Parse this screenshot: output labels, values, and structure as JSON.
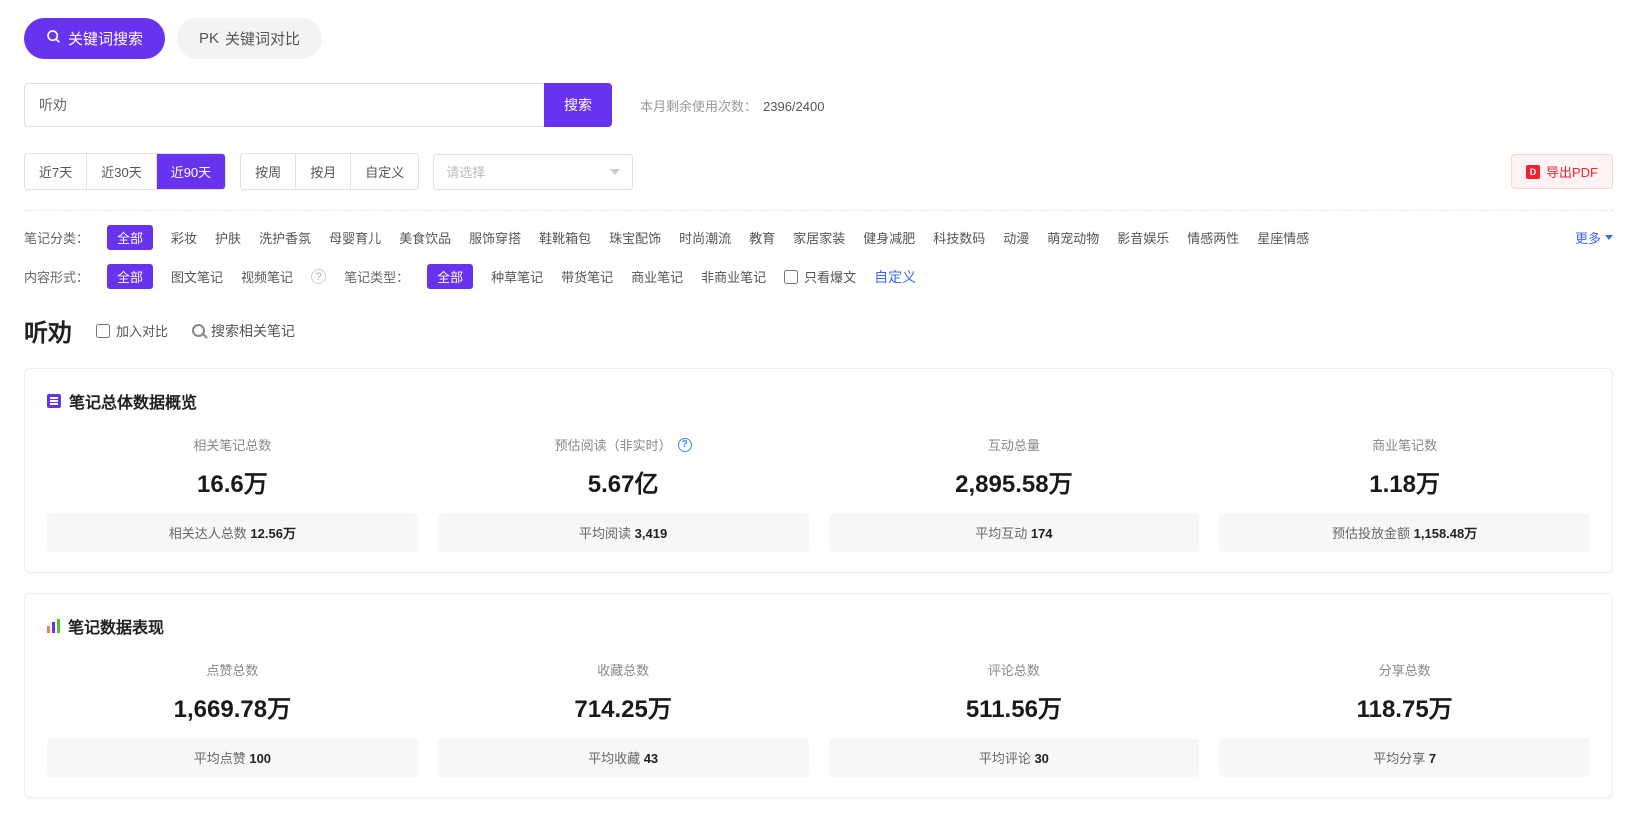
{
  "tabs": {
    "keyword_search": "关键词搜索",
    "keyword_compare": "关键词对比",
    "pk_prefix": "PK"
  },
  "search": {
    "value": "听劝",
    "button": "搜索",
    "usage_label": "本月剩余使用次数：",
    "usage_value": "2396/2400"
  },
  "time_range": {
    "d7": "近7天",
    "d30": "近30天",
    "d90": "近90天"
  },
  "granularity": {
    "week": "按周",
    "month": "按月",
    "custom": "自定义"
  },
  "date_select_placeholder": "请选择",
  "export_pdf": "导出PDF",
  "note_category": {
    "label": "笔记分类：",
    "all": "全部",
    "items": [
      "彩妆",
      "护肤",
      "洗护香氛",
      "母婴育儿",
      "美食饮品",
      "服饰穿搭",
      "鞋靴箱包",
      "珠宝配饰",
      "时尚潮流",
      "教育",
      "家居家装",
      "健身减肥",
      "科技数码",
      "动漫",
      "萌宠动物",
      "影音娱乐",
      "情感两性",
      "星座情感"
    ],
    "more": "更多"
  },
  "content_form": {
    "label": "内容形式：",
    "all": "全部",
    "items": [
      "图文笔记",
      "视频笔记"
    ]
  },
  "note_type": {
    "label": "笔记类型：",
    "all": "全部",
    "items": [
      "种草笔记",
      "带货笔记",
      "商业笔记",
      "非商业笔记"
    ],
    "hot_only": "只看爆文",
    "custom": "自定义"
  },
  "result": {
    "title": "听劝",
    "add_compare": "加入对比",
    "search_related": "搜索相关笔记"
  },
  "overview": {
    "title": "笔记总体数据概览",
    "metrics": [
      {
        "label": "相关笔记总数",
        "value": "16.6万",
        "sub_label": "相关达人总数",
        "sub_value": "12.56万"
      },
      {
        "label": "预估阅读（非实时）",
        "value": "5.67亿",
        "sub_label": "平均阅读",
        "sub_value": "3,419",
        "info": true
      },
      {
        "label": "互动总量",
        "value": "2,895.58万",
        "sub_label": "平均互动",
        "sub_value": "174"
      },
      {
        "label": "商业笔记数",
        "value": "1.18万",
        "sub_label": "预估投放金额",
        "sub_value": "1,158.48万"
      }
    ]
  },
  "performance": {
    "title": "笔记数据表现",
    "metrics": [
      {
        "label": "点赞总数",
        "value": "1,669.78万",
        "sub_label": "平均点赞",
        "sub_value": "100"
      },
      {
        "label": "收藏总数",
        "value": "714.25万",
        "sub_label": "平均收藏",
        "sub_value": "43"
      },
      {
        "label": "评论总数",
        "value": "511.56万",
        "sub_label": "平均评论",
        "sub_value": "30"
      },
      {
        "label": "分享总数",
        "value": "118.75万",
        "sub_label": "平均分享",
        "sub_value": "7"
      }
    ]
  }
}
